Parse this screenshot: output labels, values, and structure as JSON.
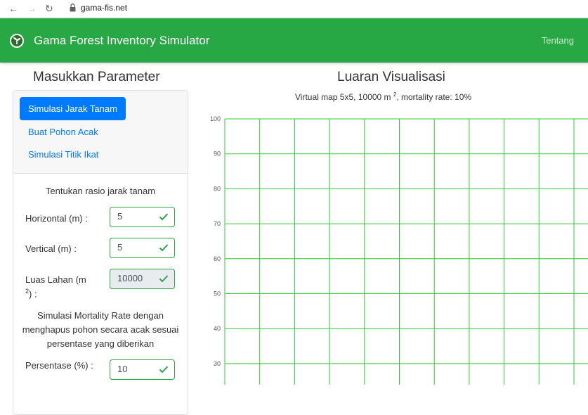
{
  "browser": {
    "url": "gama-fis.net",
    "back_icon": "←",
    "forward_icon": "→",
    "reload_icon": "↻"
  },
  "navbar": {
    "title": "Gama Forest Inventory Simulator",
    "link": "Tentang",
    "color": "#28a745"
  },
  "left": {
    "heading": "Masukkan Parameter",
    "pills": [
      {
        "label": "Simulasi Jarak Tanam",
        "active": true
      },
      {
        "label": "Buat Pohon Acak",
        "active": false
      },
      {
        "label": "Simulasi Titik Ikat",
        "active": false
      }
    ],
    "subtitle": "Tentukan rasio jarak tanam",
    "fields": [
      {
        "label": "Horizontal (m) :",
        "value": "5"
      },
      {
        "label": "Vertical (m) :",
        "value": "5"
      },
      {
        "label": "Luas Lahan (m",
        "label_sup": "2",
        "label_suffix": ") :",
        "value": "10000"
      }
    ],
    "mortality_text": "Simulasi Mortality Rate dengan menghapus pohon secara acak sesuai persentase yang diberikan",
    "percent_label": "Persentase (%) :",
    "percent_value": "10"
  },
  "right": {
    "heading": "Luaran Visualisasi",
    "subtitle_pre": "Virtual map 5x5, 10000 m",
    "subtitle_sup": "2",
    "subtitle_post": ", mortality rate: 10%"
  },
  "chart_data": {
    "type": "scatter",
    "title": "",
    "yticks": [
      100,
      90,
      80,
      70,
      60,
      50,
      40,
      30
    ],
    "y_range_visible": [
      28,
      100
    ],
    "x_grid_lines": 11,
    "grid": true,
    "grid_color": "#2ecc2e"
  }
}
